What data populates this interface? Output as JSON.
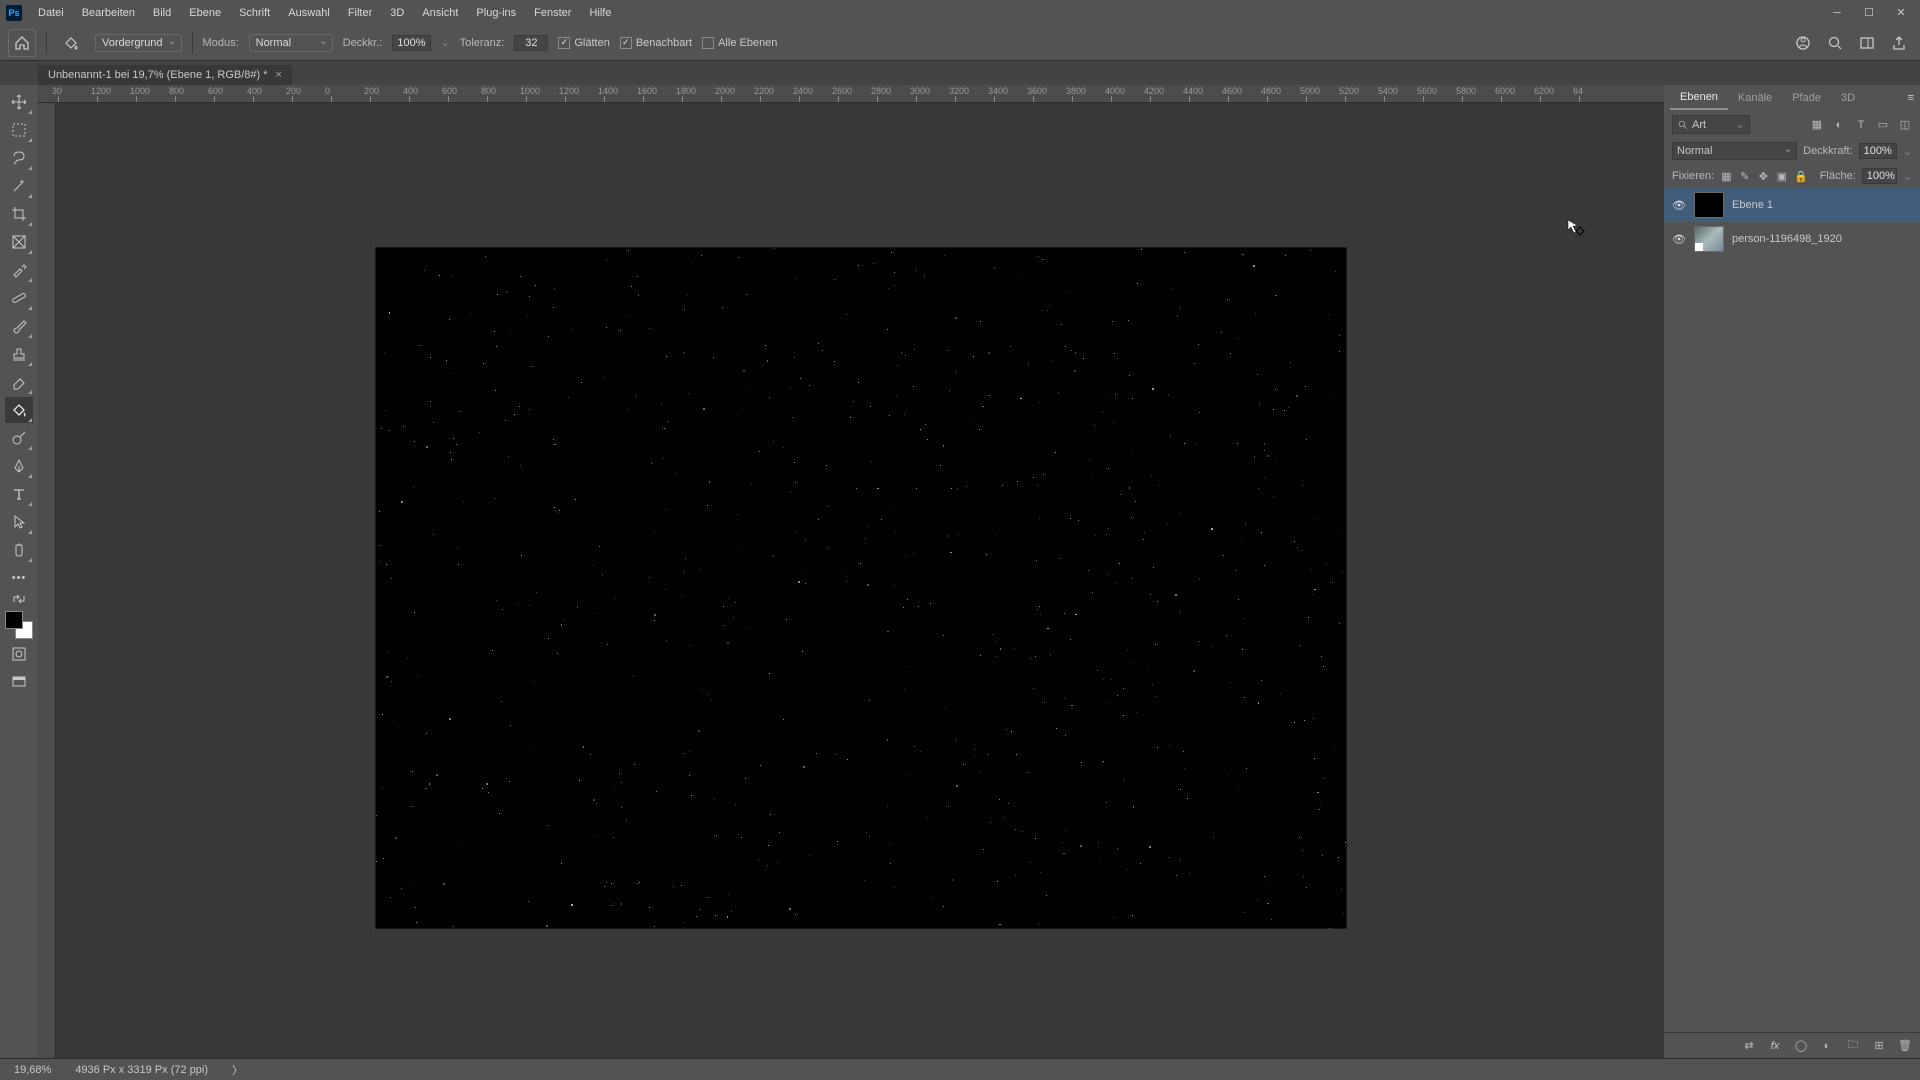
{
  "app": {
    "logo_text": "Ps"
  },
  "menu": [
    "Datei",
    "Bearbeiten",
    "Bild",
    "Ebene",
    "Schrift",
    "Auswahl",
    "Filter",
    "3D",
    "Ansicht",
    "Plug-ins",
    "Fenster",
    "Hilfe"
  ],
  "options_bar": {
    "preset_label": "Vordergrund",
    "mode_label": "Modus:",
    "mode_value": "Normal",
    "opacity_label": "Deckkr.:",
    "opacity_value": "100%",
    "tolerance_label": "Toleranz:",
    "tolerance_value": "32",
    "antialiasing_label": "Glätten",
    "antialiasing_checked": true,
    "contiguous_label": "Benachbart",
    "contiguous_checked": true,
    "all_layers_label": "Alle Ebenen",
    "all_layers_checked": false
  },
  "document": {
    "tab_title": "Unbenannt-1 bei 19,7% (Ebene 1, RGB/8#) *"
  },
  "ruler_ticks": [
    "0",
    "200",
    "400",
    "600",
    "800",
    "1000",
    "1200",
    "1400",
    "1600",
    "1800",
    "2000",
    "2200",
    "2400",
    "2600",
    "2800",
    "3000",
    "3200",
    "3400",
    "3600",
    "3800",
    "4000",
    "4200",
    "4400",
    "4600",
    "4800",
    "5000",
    "5200",
    "5400",
    "5600",
    "5800",
    "6000",
    "6200",
    "64"
  ],
  "ruler_neg": [
    "30",
    "1200",
    "1000",
    "800",
    "600",
    "400",
    "200"
  ],
  "panels": {
    "tabs": [
      "Ebenen",
      "Kanäle",
      "Pfade",
      "3D"
    ],
    "active_tab": 0,
    "search_label": "Art",
    "blend_mode": "Normal",
    "opacity_label": "Deckkraft:",
    "opacity_value": "100%",
    "lock_label": "Fixieren:",
    "fill_label": "Fläche:",
    "fill_value": "100%",
    "layers": [
      {
        "name": "Ebene 1",
        "visible": true,
        "selected": true,
        "thumb": "black"
      },
      {
        "name": "person-1196498_1920",
        "visible": true,
        "selected": false,
        "thumb": "image"
      }
    ]
  },
  "status": {
    "zoom": "19,68%",
    "doc_info": "4936 Px x 3319 Px (72 ppi)",
    "arrow": "〉"
  },
  "colors": {
    "canvas_bg": "#383838",
    "panel_bg": "#535353",
    "select_bg": "#425d7a"
  }
}
